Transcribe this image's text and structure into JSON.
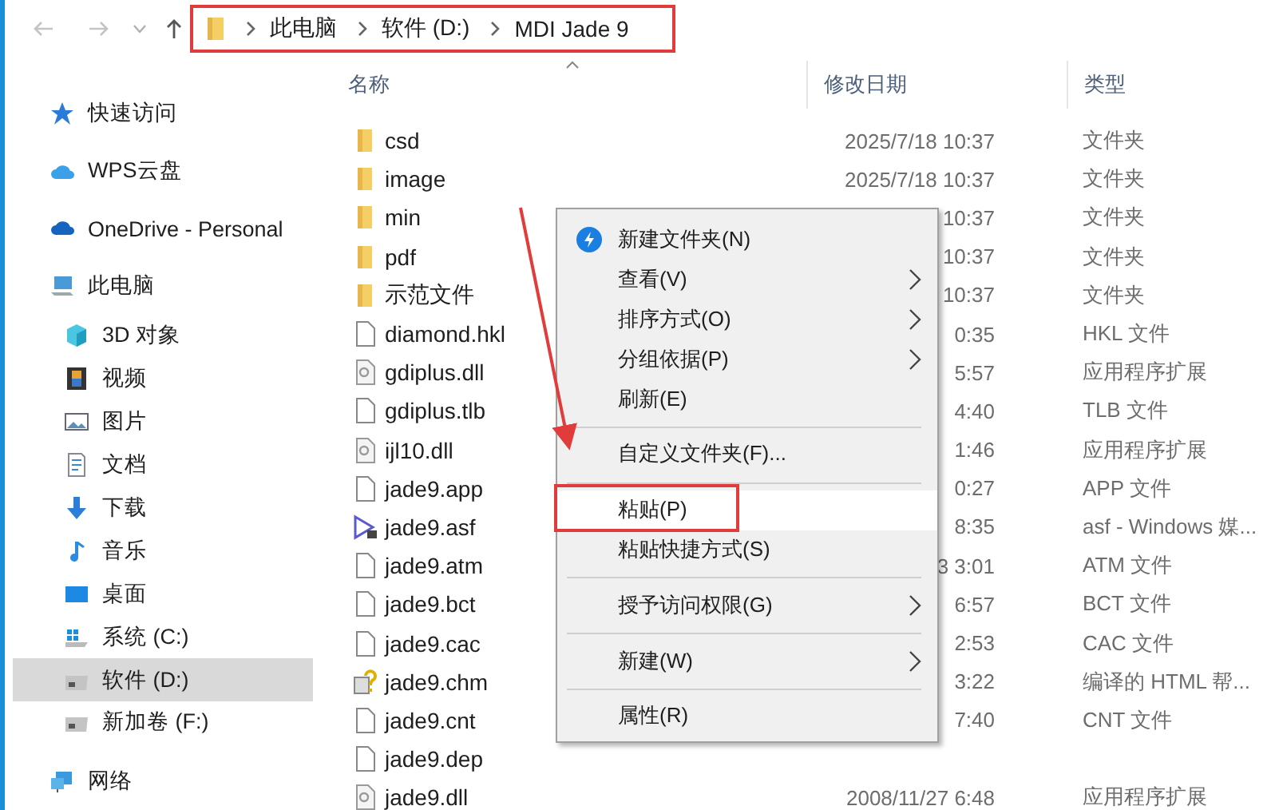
{
  "address_bar": {
    "path": [
      {
        "label": "此电脑"
      },
      {
        "label": "软件 (D:)"
      },
      {
        "label": "MDI Jade 9"
      }
    ]
  },
  "sidebar": {
    "items": [
      {
        "label": "快速访问",
        "kind": "star",
        "selected": false
      },
      {
        "label": "WPS云盘",
        "kind": "wps-cloud",
        "selected": false
      },
      {
        "label": "OneDrive - Personal",
        "kind": "cloud",
        "selected": false
      },
      {
        "label": "此电脑",
        "kind": "computer",
        "selected": false,
        "children": [
          {
            "label": "3D 对象",
            "kind": "cube",
            "selected": false
          },
          {
            "label": "视频",
            "kind": "film",
            "selected": false
          },
          {
            "label": "图片",
            "kind": "image",
            "selected": false
          },
          {
            "label": "文档",
            "kind": "document",
            "selected": false
          },
          {
            "label": "下载",
            "kind": "download",
            "selected": false
          },
          {
            "label": "音乐",
            "kind": "music",
            "selected": false
          },
          {
            "label": "桌面",
            "kind": "desktop",
            "selected": false
          },
          {
            "label": "系统 (C:)",
            "kind": "system-drive",
            "selected": false
          },
          {
            "label": "软件 (D:)",
            "kind": "drive",
            "selected": true
          },
          {
            "label": "新加卷 (F:)",
            "kind": "drive",
            "selected": false
          }
        ]
      },
      {
        "label": "网络",
        "kind": "network",
        "selected": false
      }
    ]
  },
  "file_list": {
    "columns": [
      "名称",
      "修改日期",
      "类型"
    ],
    "rows": [
      {
        "name": "csd",
        "kind": "folder",
        "modified": "2025/7/18 10:37",
        "type": "文件夹"
      },
      {
        "name": "image",
        "kind": "folder",
        "modified": "2025/7/18 10:37",
        "type": "文件夹"
      },
      {
        "name": "min",
        "kind": "folder",
        "modified": "10:37",
        "type": "文件夹"
      },
      {
        "name": "pdf",
        "kind": "folder",
        "modified": "10:37",
        "type": "文件夹"
      },
      {
        "name": "示范文件",
        "kind": "folder",
        "modified": "10:37",
        "type": "文件夹"
      },
      {
        "name": "diamond.hkl",
        "kind": "file",
        "modified": "0:35",
        "type": "HKL 文件"
      },
      {
        "name": "gdiplus.dll",
        "kind": "library",
        "modified": "5:57",
        "type": "应用程序扩展"
      },
      {
        "name": "gdiplus.tlb",
        "kind": "file",
        "modified": "4:40",
        "type": "TLB 文件"
      },
      {
        "name": "ijl10.dll",
        "kind": "library",
        "modified": "1:46",
        "type": "应用程序扩展"
      },
      {
        "name": "jade9.app",
        "kind": "file",
        "modified": "0:27",
        "type": "APP 文件"
      },
      {
        "name": "jade9.asf",
        "kind": "media",
        "modified": "8:35",
        "type": "asf - Windows 媒..."
      },
      {
        "name": "jade9.atm",
        "kind": "file",
        "modified": "3 3:01",
        "type": "ATM 文件"
      },
      {
        "name": "jade9.bct",
        "kind": "file",
        "modified": "6:57",
        "type": "BCT 文件"
      },
      {
        "name": "jade9.cac",
        "kind": "file",
        "modified": "2:53",
        "type": "CAC 文件"
      },
      {
        "name": "jade9.chm",
        "kind": "help",
        "modified": "3:22",
        "type": "编译的 HTML 帮..."
      },
      {
        "name": "jade9.cnt",
        "kind": "file",
        "modified": "7:40",
        "type": "CNT 文件"
      },
      {
        "name": "jade9.dep",
        "kind": "file"
      },
      {
        "name": "jade9.dll",
        "kind": "library",
        "modified": "2008/11/27 6:48",
        "type": "应用程序扩展"
      }
    ]
  },
  "context_menu": {
    "items": [
      {
        "label": "新建文件夹(N)",
        "kind": "app",
        "submenu": false,
        "selected": false
      },
      {
        "label": "查看(V)",
        "kind": "command",
        "submenu": true,
        "selected": false
      },
      {
        "label": "排序方式(O)",
        "kind": "command",
        "submenu": true,
        "selected": false
      },
      {
        "label": "分组依据(P)",
        "kind": "command",
        "submenu": true,
        "selected": false
      },
      {
        "label": "刷新(E)",
        "kind": "command",
        "submenu": false,
        "selected": false
      },
      {
        "label": "自定义文件夹(F)...",
        "kind": "command",
        "submenu": false,
        "selected": false,
        "separator_before": true
      },
      {
        "label": "粘贴(P)",
        "kind": "command",
        "submenu": false,
        "selected": true,
        "separator_before": true
      },
      {
        "label": "粘贴快捷方式(S)",
        "kind": "command",
        "submenu": false,
        "selected": false
      },
      {
        "label": "授予访问权限(G)",
        "kind": "command",
        "submenu": true,
        "selected": false,
        "separator_before": true
      },
      {
        "label": "新建(W)",
        "kind": "command",
        "submenu": true,
        "selected": false,
        "separator_before": true
      },
      {
        "label": "属性(R)",
        "kind": "command",
        "submenu": false,
        "selected": false,
        "separator_before": true
      }
    ]
  }
}
